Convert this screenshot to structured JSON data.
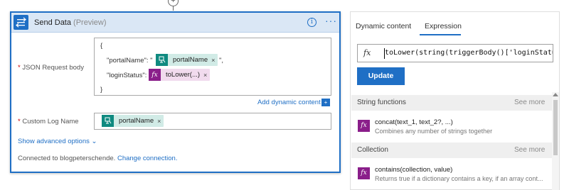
{
  "action_card": {
    "title": "Send Data",
    "title_suffix": "(Preview)",
    "info_icon_glyph": "i",
    "more_glyph": "···",
    "json_request": {
      "required_mark": "*",
      "label": "JSON Request body",
      "line_open": "{",
      "line_portal_key": "\"portalName\": \"",
      "line_portal_suffix": "\",",
      "line_login_key": "\"loginStatus\":",
      "line_close": "}",
      "portal_token": "portalName",
      "login_token": "toLower(...)",
      "remove_glyph": "×"
    },
    "add_dynamic_content": "Add dynamic content",
    "add_dynamic_icon_glyph": "+",
    "custom_log": {
      "required_mark": "*",
      "label": "Custom Log Name",
      "token": "portalName",
      "remove_glyph": "×"
    },
    "show_advanced": "Show advanced options",
    "show_advanced_chevron": "⌄",
    "connected_text": "Connected to blogpeterschende.",
    "change_connection": "Change connection."
  },
  "expression_panel": {
    "tabs": [
      {
        "label": "Dynamic content",
        "active": false
      },
      {
        "label": "Expression",
        "active": true
      }
    ],
    "fx_glyph": "fx",
    "expression_value": "toLower(string(triggerBody()['loginStatus'",
    "update_label": "Update",
    "sections": [
      {
        "title": "String functions",
        "see_more": "See more",
        "items": [
          {
            "name": "concat(text_1, text_2?, ...)",
            "description": "Combines any number of strings together"
          }
        ]
      },
      {
        "title": "Collection",
        "see_more": "See more",
        "items": [
          {
            "name": "contains(collection, value)",
            "description": "Returns true if a dictionary contains a key, if an array cont..."
          }
        ]
      }
    ]
  },
  "colors": {
    "accent": "#1f6fc5",
    "header_bg": "#dae7f5",
    "token_green": "#0f8a80",
    "token_pink": "#8a1e8a"
  },
  "icons": {
    "card_icon": "send-data-icon",
    "dynamic_token_icon": "dynamic-content-icon",
    "function_icon": "fx-icon"
  }
}
